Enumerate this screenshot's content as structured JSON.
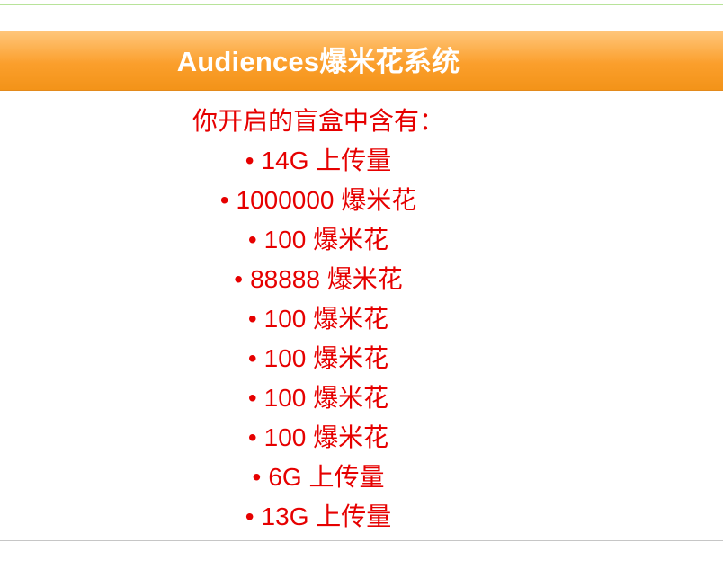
{
  "panel": {
    "title": "Audiences爆米花系统"
  },
  "result": {
    "intro": "你开启的盲盒中含有：",
    "bullet": "•",
    "items": [
      "14G 上传量",
      "1000000 爆米花",
      "100 爆米花",
      "88888 爆米花",
      "100 爆米花",
      "100 爆米花",
      "100 爆米花",
      "100 爆米花",
      "6G 上传量",
      "13G 上传量"
    ]
  },
  "colors": {
    "header_gradient_top": "#ffc67a",
    "header_gradient_bottom": "#f39318",
    "text_red": "#e60000",
    "top_rule_green": "#b8e39a"
  }
}
